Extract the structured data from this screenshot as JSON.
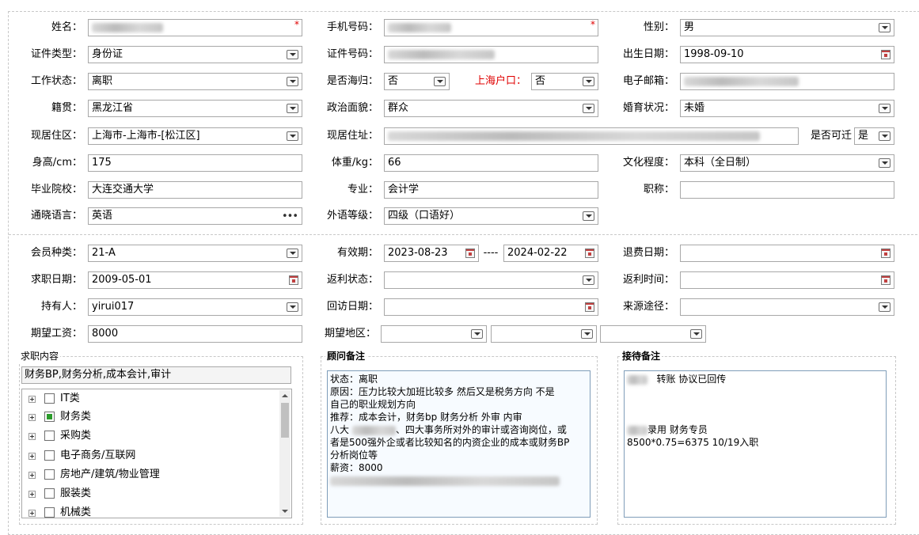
{
  "form": {
    "name": {
      "label": "姓名：",
      "required": "*"
    },
    "phone": {
      "label": "手机号码：",
      "required": "*"
    },
    "gender": {
      "label": "性别：",
      "value": "男"
    },
    "id_type": {
      "label": "证件类型：",
      "value": "身份证"
    },
    "id_number": {
      "label": "证件号码："
    },
    "birth_date": {
      "label": "出生日期：",
      "value": "1998-09-10"
    },
    "work_status": {
      "label": "工作状态：",
      "value": "离职"
    },
    "returnee": {
      "label": "是否海归：",
      "value": "否"
    },
    "shanghai_hukou": {
      "label": "上海户口：",
      "value": "否"
    },
    "email": {
      "label": "电子邮箱："
    },
    "native_place": {
      "label": "籍贯：",
      "value": "黑龙江省"
    },
    "political_status": {
      "label": "政治面貌：",
      "value": "群众"
    },
    "marital_status": {
      "label": "婚育状况：",
      "value": "未婚"
    },
    "residence_area": {
      "label": "现居住区：",
      "value": "上海市-上海市-[松江区]"
    },
    "residence_address": {
      "label": "现居住址："
    },
    "relocatable": {
      "label": "是否可迁",
      "value": "是"
    },
    "height": {
      "label": "身高/cm：",
      "value": "175"
    },
    "weight": {
      "label": "体重/kg：",
      "value": "66"
    },
    "education": {
      "label": "文化程度：",
      "value": "本科（全日制）"
    },
    "school": {
      "label": "毕业院校：",
      "value": "大连交通大学"
    },
    "major": {
      "label": "专业：",
      "value": "会计学"
    },
    "title": {
      "label": "职称：",
      "value": ""
    },
    "languages": {
      "label": "通晓语言：",
      "value": "英语",
      "more": "•••"
    },
    "foreign_level": {
      "label": "外语等级：",
      "value": "四级（口语好）"
    }
  },
  "membership": {
    "member_type": {
      "label": "会员种类：",
      "value": "21-A"
    },
    "validity": {
      "label": "有效期：",
      "start": "2023-08-23",
      "sep": "----",
      "end": "2024-02-22"
    },
    "refund_date": {
      "label": "退费日期：",
      "value": ""
    },
    "job_seek_date": {
      "label": "求职日期：",
      "value": "2009-05-01"
    },
    "rebate_status": {
      "label": "返利状态：",
      "value": ""
    },
    "rebate_time": {
      "label": "返利时间：",
      "value": ""
    },
    "holder": {
      "label": "持有人：",
      "value": "yirui017"
    },
    "visit_date": {
      "label": "回访日期：",
      "value": ""
    },
    "source": {
      "label": "来源途径：",
      "value": ""
    },
    "expected_salary": {
      "label": "期望工资：",
      "value": "8000"
    },
    "expected_area": {
      "label": "期望地区："
    }
  },
  "job_content": {
    "title": "求职内容",
    "summary": "财务BP,财务分析,成本会计,审计",
    "categories": [
      {
        "label": "IT类",
        "checked": false
      },
      {
        "label": "财务类",
        "checked": true
      },
      {
        "label": "采购类",
        "checked": false
      },
      {
        "label": "电子商务/互联网",
        "checked": false
      },
      {
        "label": "房地产/建筑/物业管理",
        "checked": false
      },
      {
        "label": "服装类",
        "checked": false
      },
      {
        "label": "机械类",
        "checked": false
      }
    ]
  },
  "advisor_notes": {
    "title": "顾问备注",
    "lines": [
      "状态：离职",
      "原因：压力比较大加班比较多 然后又是税务方向 不是",
      "自己的职业规划方向",
      "推荐：成本会计，财务bp  财务分析   外审  内审",
      "八大",
      "、四大事务所对外的审计或咨询岗位，或",
      "者是500强外企或者比较知名的内资企业的成本或财务BP",
      "分析岗位等",
      "薪资：8000"
    ]
  },
  "reception_notes": {
    "title": "接待备注",
    "line1": "转账  协议已回传",
    "line2": "录用  财务专员",
    "line3": "8500*0.75=6375  10/19入职"
  }
}
